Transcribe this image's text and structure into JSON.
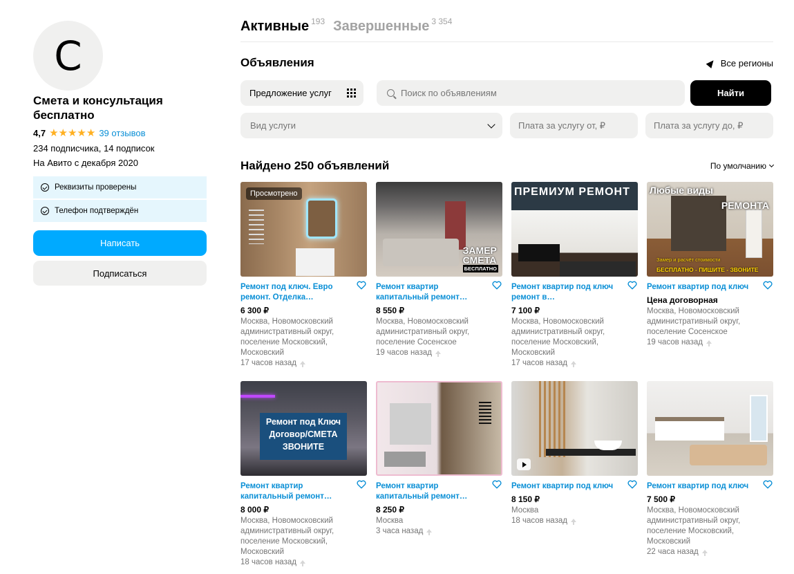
{
  "profile": {
    "avatar_letter": "С",
    "name": "Смета и консультация бесплатно",
    "rating": "4,7",
    "stars": "★★★★★",
    "reviews": "39 отзывов",
    "subscribers": "234 подписчика, 14 подписок",
    "since": "На Авито с декабря 2020",
    "badges": [
      "Реквизиты проверены",
      "Телефон подтверждён"
    ],
    "write_label": "Написать",
    "subscribe_label": "Подписаться"
  },
  "tabs": [
    {
      "label": "Активные",
      "count": "193"
    },
    {
      "label": "Завершенные",
      "count": "3 354"
    }
  ],
  "section": {
    "title": "Объявления",
    "region": "Все регионы"
  },
  "filters": {
    "category": "Предложение услуг",
    "search_placeholder": "Поиск по объявлениям",
    "find_label": "Найти",
    "service_type": "Вид услуги",
    "price_from_placeholder": "Плата за услугу от, ₽",
    "price_to_placeholder": "Плата за услугу до, ₽"
  },
  "results": {
    "found": "Найдено 250 объявлений",
    "sort": "По умолчанию"
  },
  "colors": {
    "accent": "#00aaff",
    "link": "#0a8fd6",
    "star": "#ffb021",
    "badge_bg": "#e5f6fd"
  },
  "listings": [
    {
      "title": "Ремонт под ключ. Евро ремонт. Отделка…",
      "price": "6 300 ₽",
      "location": "Москва, Новомосковский административный округ, поселение Московский, Московский",
      "time": "17 часов назад",
      "badge": "Просмотрено"
    },
    {
      "title": "Ремонт квартир капитальный ремонт…",
      "price": "8 550 ₽",
      "location": "Москва, Новомосковский административный округ, поселение Сосенское",
      "time": "19 часов назад",
      "image_text": [
        "ЗАМЕР",
        "СМЕТА",
        "БЕСПЛАТНО"
      ]
    },
    {
      "title": "Ремонт квартир под ключ ремонт в…",
      "price": "7 100 ₽",
      "location": "Москва, Новомосковский административный округ, поселение Московский, Московский",
      "time": "17 часов назад",
      "image_text": [
        "ПРЕМИУМ РЕМОНТ"
      ]
    },
    {
      "title": "Ремонт квартир под ключ",
      "price": "Цена договорная",
      "location": "Москва, Новомосковский административный округ, поселение Сосенское",
      "time": "19 часов назад",
      "image_text": [
        "Любые виды",
        "РЕМОНТА",
        "Замер и расчёт стоимости",
        "БЕСПЛАТНО - ПИШИТЕ - ЗВОНИТЕ"
      ]
    },
    {
      "title": "Ремонт квартир капитальный ремонт…",
      "price": "8 000 ₽",
      "location": "Москва, Новомосковский административный округ, поселение Московский, Московский",
      "time": "18 часов назад",
      "image_text": [
        "Ремонт под Ключ",
        "Договор/СМЕТА",
        "ЗВОНИТЕ"
      ]
    },
    {
      "title": "Ремонт квартир капитальный ремонт…",
      "price": "8 250 ₽",
      "location": "Москва",
      "time": "3 часа назад"
    },
    {
      "title": "Ремонт квартир под ключ",
      "price": "8 150 ₽",
      "location": "Москва",
      "time": "18 часов назад",
      "video": true
    },
    {
      "title": "Ремонт квартир под ключ",
      "price": "7 500 ₽",
      "location": "Москва, Новомосковский административный округ, поселение Московский, Московский",
      "time": "22 часа назад"
    }
  ]
}
